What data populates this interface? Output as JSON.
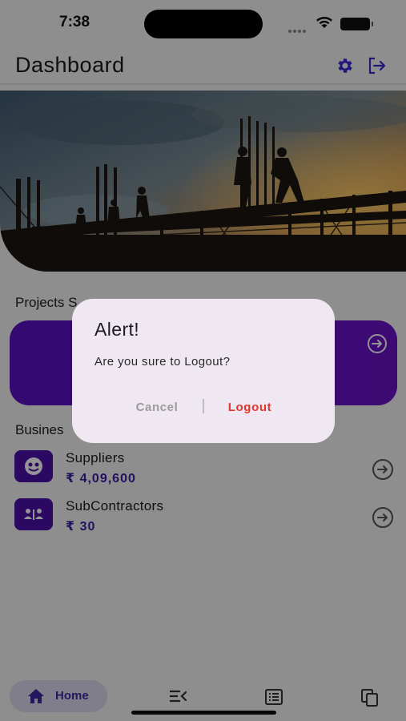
{
  "status_bar": {
    "time": "7:38"
  },
  "header": {
    "title": "Dashboard"
  },
  "sections": {
    "projects_label": "Projects S",
    "business_label": "Busines"
  },
  "business": [
    {
      "name": "Suppliers",
      "amount": "₹ 4,09,600"
    },
    {
      "name": "SubContractors",
      "amount": "₹ 30"
    }
  ],
  "bottom_nav": {
    "home_label": "Home"
  },
  "dialog": {
    "title": "Alert!",
    "message": "Are you sure to Logout?",
    "cancel_label": "Cancel",
    "confirm_label": "Logout"
  },
  "colors": {
    "accent": "#5a10c4",
    "danger": "#e5352b",
    "dialog_bg": "#efe8f2"
  },
  "icons": [
    "gear-icon",
    "logout-icon",
    "arrow-circle-icon",
    "suppliers-icon",
    "subcontractors-icon",
    "home-icon",
    "menu-collapse-icon",
    "list-icon",
    "copy-icon"
  ]
}
